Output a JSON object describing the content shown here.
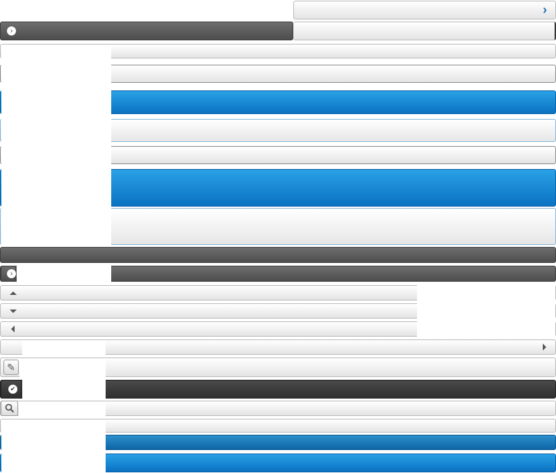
{
  "colors": {
    "accent_blue": "#0a72c2",
    "dark_gray": "#4d4d4d",
    "light_gray": "#e4e4e4",
    "border_gray": "#b9b9b9"
  },
  "icons": {
    "top_chevron": "chevron-right-icon",
    "dark_bar_arrow": "arrow-right-circle-icon",
    "up": "triangle-up-icon",
    "down": "triangle-down-icon",
    "left": "triangle-left-icon",
    "right": "triangle-right-icon",
    "edit": "pencil-icon",
    "check": "check-circle-icon",
    "search": "magnifier-icon"
  },
  "glyphs": {
    "chevron": "›",
    "arrow": "›",
    "check": "✔",
    "pencil": "✎"
  }
}
